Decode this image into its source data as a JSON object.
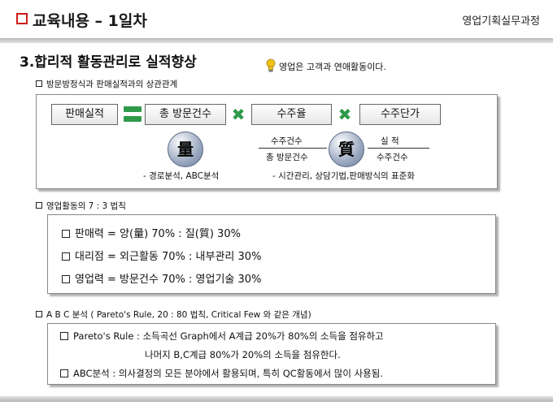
{
  "header": {
    "title": "교육내용 – 1일차",
    "right_label": "영업기획실무과정"
  },
  "section": {
    "title": "3.합리적 활동관리로 실적향상",
    "note": "영업은 고객과 연애활동이다."
  },
  "block1": {
    "heading": "방문방정식과 판매실적과의 상관관계",
    "formula": [
      "판매실적",
      "총 방문건수",
      "수주율",
      "수주단가"
    ],
    "quantity": {
      "symbol": "量",
      "note": "- 경로분석, ABC분석"
    },
    "fraction": {
      "numerator": "수주건수",
      "denominator": "총 방문건수"
    },
    "quality": {
      "symbol": "質",
      "numerator": "실      적",
      "denominator": "수주건수",
      "note": "- 시간관리, 상담기법,판매방식의 표준화"
    }
  },
  "block2": {
    "heading": "영업활동의  7 : 3  법칙",
    "lines": [
      "판매력 = 양(量)    70% : 질(質)    30%",
      "대리점 = 외근활동 70% : 내부관리 30%",
      "영업력 = 방문건수 70% : 영업기술 30%"
    ]
  },
  "block3": {
    "heading": "A B C 분석 ( Pareto's Rule, 20 : 80 법칙, Critical Few 와 같은 개념)",
    "lines": [
      "Pareto's Rule : 소득곡선 Graph에서 A계급 20%가 80%의 소득을 점유하고",
      "나머지 B,C계급 80%가 20%의 소득을 점유한다.",
      "ABC분석 : 의사결정의 모든 분야에서 활용되며, 특히 QC활동에서 많이 사용됨."
    ]
  },
  "colors": {
    "accent_red": "#d01818",
    "accent_green": "#2e9a4a",
    "circle_fill": "#9aa8c0"
  },
  "icons": {
    "header": "red-square-bullet-icon",
    "note": "lightbulb-icon",
    "operators": [
      "equals-icon",
      "multiply-icon"
    ]
  }
}
